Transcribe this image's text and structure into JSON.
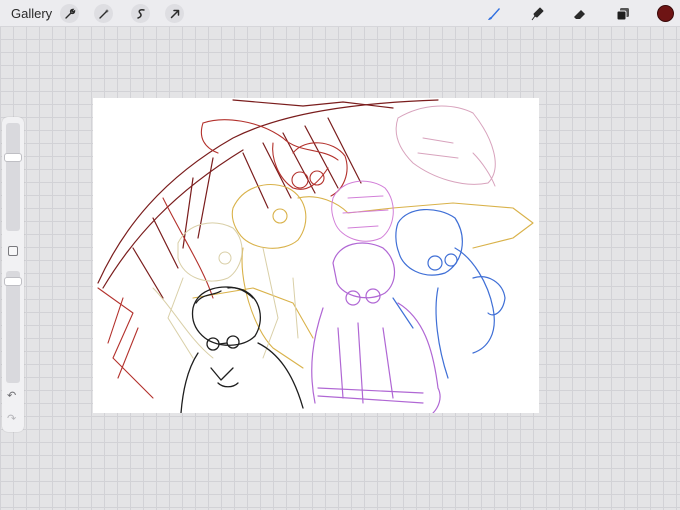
{
  "topbar": {
    "gallery_label": "Gallery",
    "left_tools": [
      {
        "icon": "wrench-icon"
      },
      {
        "icon": "magic-wand-icon"
      },
      {
        "icon": "selection-icon"
      },
      {
        "icon": "transform-arrow-icon"
      }
    ],
    "right_tools": [
      {
        "icon": "brush-icon",
        "active": true,
        "color": "#2f6fe0"
      },
      {
        "icon": "smudge-icon"
      },
      {
        "icon": "eraser-icon"
      },
      {
        "icon": "layers-icon"
      }
    ],
    "current_color": "#6e1414"
  },
  "sidebar": {
    "brush_size_level": 0.75,
    "opacity_level": 0.95,
    "undo_icon": "undo-icon",
    "redo_icon": "redo-icon"
  },
  "canvas": {
    "description_colors": {
      "red": "#b3312c",
      "dark_red": "#7a1d1d",
      "pink": "#d8a3bd",
      "yellow": "#d9b24a",
      "beige": "#d9cfa7",
      "purple": "#b067d4",
      "blue": "#3f6fd6",
      "black": "#1e1e1e",
      "magenta": "#d27fd8"
    }
  }
}
